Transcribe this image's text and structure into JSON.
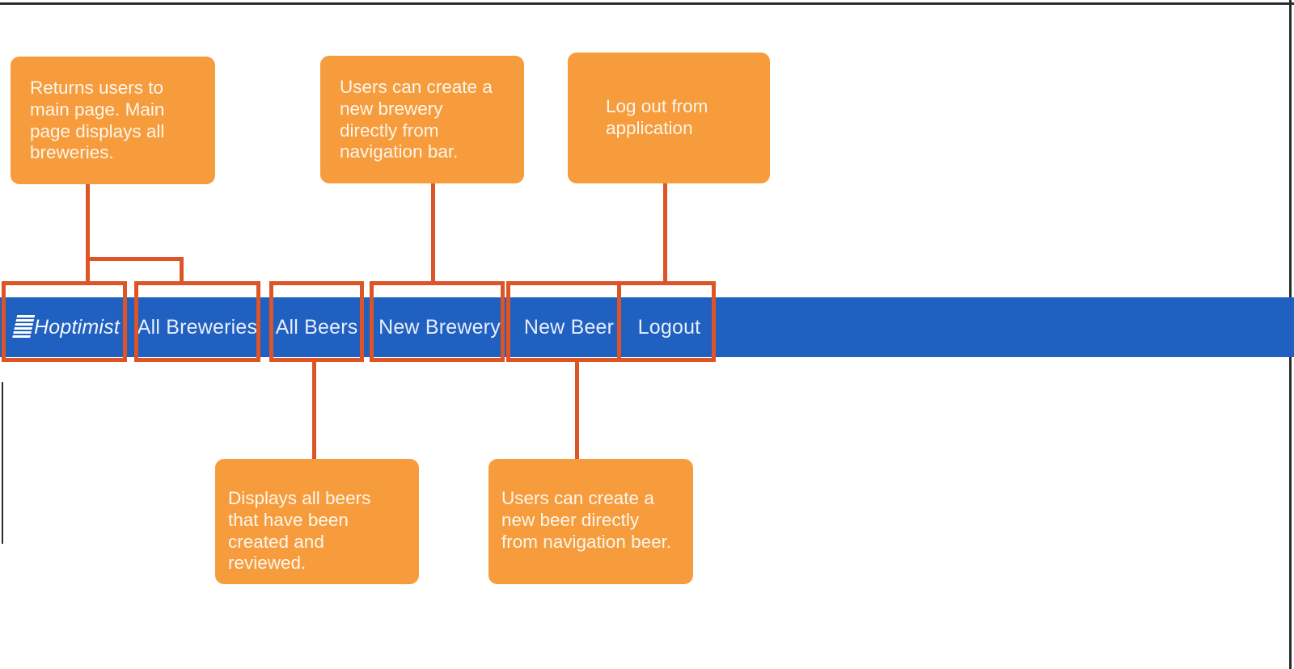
{
  "diagram": {
    "title": "Hoptimist navigation bar annotated diagram",
    "colors": {
      "navbar_blue": "#2060c0",
      "callout_orange": "#F79C3C",
      "connector_orange": "#DD5527",
      "nav_text": "#e8eefb",
      "callout_text": "#fdf6ec",
      "background": "#ffffff"
    }
  },
  "navbar": {
    "brand": {
      "label": "Hoptimist",
      "icon": "stacked-bars-logo-icon"
    },
    "items": [
      {
        "id": "all-breweries",
        "label": "All Breweries"
      },
      {
        "id": "all-beers",
        "label": "All Beers"
      },
      {
        "id": "new-brewery",
        "label": "New Brewery"
      },
      {
        "id": "new-beer",
        "label": "New Beer"
      },
      {
        "id": "logout",
        "label": "Logout"
      }
    ]
  },
  "callouts": [
    {
      "id": "brand-callout",
      "target": "Hoptimist / All Breweries",
      "text": "Returns users to main page. Main page displays all breweries."
    },
    {
      "id": "new-brewery-callout",
      "target": "New Brewery",
      "text": "Users can create a new brewery directly from navigation bar."
    },
    {
      "id": "logout-callout",
      "target": "Logout",
      "text": "Log out from application"
    },
    {
      "id": "all-beers-callout",
      "target": "All Beers",
      "text": "Displays all beers that have been created and reviewed."
    },
    {
      "id": "new-beer-callout",
      "target": "New Beer",
      "text": "Users can create a new beer directly from navigation beer."
    }
  ]
}
